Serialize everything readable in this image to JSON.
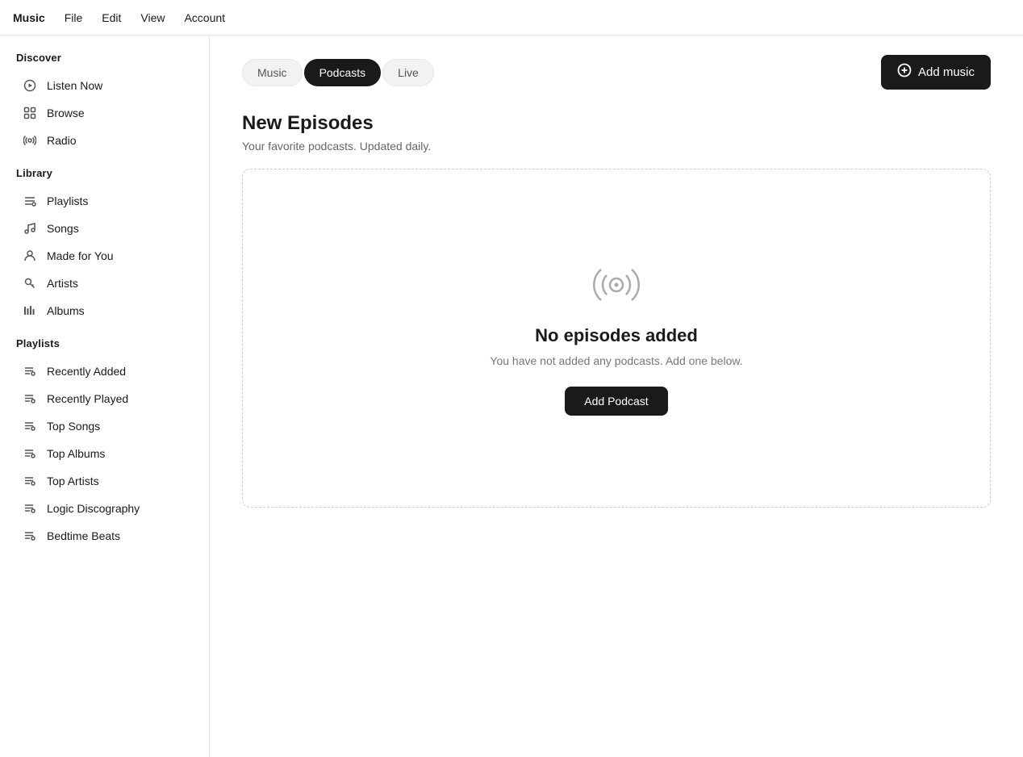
{
  "menubar": {
    "items": [
      "Music",
      "File",
      "Edit",
      "View",
      "Account"
    ]
  },
  "sidebar": {
    "discover_label": "Discover",
    "discover_items": [
      {
        "id": "listen-now",
        "label": "Listen Now",
        "icon": "play-circle"
      },
      {
        "id": "browse",
        "label": "Browse",
        "icon": "grid"
      },
      {
        "id": "radio",
        "label": "Radio",
        "icon": "radio"
      }
    ],
    "library_label": "Library",
    "library_items": [
      {
        "id": "playlists",
        "label": "Playlists",
        "icon": "list"
      },
      {
        "id": "songs",
        "label": "Songs",
        "icon": "music-note"
      },
      {
        "id": "made-for-you",
        "label": "Made for You",
        "icon": "person"
      },
      {
        "id": "artists",
        "label": "Artists",
        "icon": "key"
      },
      {
        "id": "albums",
        "label": "Albums",
        "icon": "bars"
      }
    ],
    "playlists_label": "Playlists",
    "playlist_items": [
      {
        "id": "recently-added",
        "label": "Recently Added",
        "icon": "list"
      },
      {
        "id": "recently-played",
        "label": "Recently Played",
        "icon": "list"
      },
      {
        "id": "top-songs",
        "label": "Top Songs",
        "icon": "list"
      },
      {
        "id": "top-albums",
        "label": "Top Albums",
        "icon": "list"
      },
      {
        "id": "top-artists",
        "label": "Top Artists",
        "icon": "list"
      },
      {
        "id": "logic-discography",
        "label": "Logic Discography",
        "icon": "list"
      },
      {
        "id": "bedtime-beats",
        "label": "Bedtime Beats",
        "icon": "list"
      }
    ]
  },
  "tabs": {
    "items": [
      {
        "id": "music",
        "label": "Music",
        "active": false
      },
      {
        "id": "podcasts",
        "label": "Podcasts",
        "active": true
      },
      {
        "id": "live",
        "label": "Live",
        "active": false
      }
    ],
    "add_music_label": "Add music"
  },
  "main": {
    "section_title": "New Episodes",
    "section_subtitle": "Your favorite podcasts. Updated daily.",
    "empty_title": "No episodes added",
    "empty_subtitle": "You have not added any podcasts. Add one below.",
    "add_podcast_label": "Add Podcast"
  }
}
